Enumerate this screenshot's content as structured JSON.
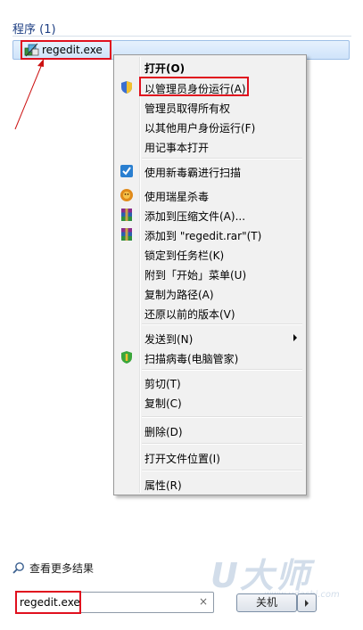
{
  "section": {
    "header": "程序 (1)"
  },
  "result": {
    "label": "regedit.exe",
    "icon": "regedit-icon"
  },
  "menu": {
    "items": [
      {
        "label": "打开(O)",
        "bold": true,
        "icon": null
      },
      {
        "label": "以管理员身份运行(A)",
        "icon": "uac-shield-icon"
      },
      {
        "label": "管理员取得所有权",
        "icon": null
      },
      {
        "label": "以其他用户身份运行(F)",
        "icon": null
      },
      {
        "label": "用记事本打开",
        "icon": null
      },
      {
        "label": "使用新毒霸进行扫描",
        "icon": "antivirus-icon"
      },
      {
        "label": "使用瑞星杀毒",
        "icon": "rising-lion-icon"
      },
      {
        "label": "添加到压缩文件(A)...",
        "icon": "winrar-icon"
      },
      {
        "label": "添加到 \"regedit.rar\"(T)",
        "icon": "winrar-icon"
      },
      {
        "label": "锁定到任务栏(K)",
        "icon": null
      },
      {
        "label": "附到「开始」菜单(U)",
        "icon": null
      },
      {
        "label": "复制为路径(A)",
        "icon": null
      },
      {
        "label": "还原以前的版本(V)",
        "icon": null
      },
      {
        "label": "发送到(N)",
        "icon": null,
        "submenu": true
      },
      {
        "label": "扫描病毒(电脑管家)",
        "icon": "tencent-shield-icon"
      },
      {
        "label": "剪切(T)",
        "icon": null
      },
      {
        "label": "复制(C)",
        "icon": null
      },
      {
        "label": "删除(D)",
        "icon": null
      },
      {
        "label": "打开文件位置(I)",
        "icon": null
      },
      {
        "label": "属性(R)",
        "icon": null
      }
    ]
  },
  "bottom": {
    "more_results": "查看更多结果",
    "search_value": "regedit.exe",
    "clear_glyph": "×",
    "shutdown_label": "关机"
  },
  "watermark": {
    "logo": "U大师",
    "url": "www.udashi.com"
  },
  "colors": {
    "highlight_box": "#e0101e",
    "header_text": "#1e3f83",
    "arrow": "#cc1010"
  }
}
